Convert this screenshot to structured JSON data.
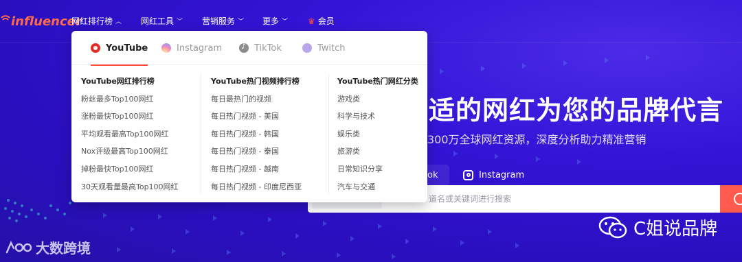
{
  "brand": {
    "logo_text": "influencer"
  },
  "nav": {
    "items": [
      {
        "label": "网红排行榜",
        "chevron": "up"
      },
      {
        "label": "网红工具",
        "chevron": "down"
      },
      {
        "label": "营销服务",
        "chevron": "down"
      },
      {
        "label": "更多",
        "chevron": "down"
      }
    ],
    "member_label": "会员"
  },
  "hero": {
    "title": "适的网红为您的品牌代言",
    "subtitle": "300万全球网红资源，深度分析助力精准营销",
    "platforms": [
      {
        "label": "ok",
        "icon": "tiktok-icon"
      },
      {
        "label": "Instagram",
        "icon": "instagram-icon"
      }
    ],
    "search": {
      "placeholder": "道名或关键词进行搜索"
    }
  },
  "dropdown": {
    "tabs": [
      {
        "label": "YouTube",
        "icon": "youtube-icon",
        "active": true
      },
      {
        "label": "Instagram",
        "icon": "instagram-icon",
        "active": false
      },
      {
        "label": "TikTok",
        "icon": "tiktok-icon",
        "active": false
      },
      {
        "label": "Twitch",
        "icon": "twitch-icon",
        "active": false
      }
    ],
    "columns": [
      {
        "heading": "YouTube网红排行榜",
        "links": [
          "粉丝最多Top100网红",
          "涨粉最快Top100网红",
          "平均观看最高Top100网红",
          "Nox评级最高Top100网红",
          "掉粉最快Top100网红",
          "30天观看量最高Top100网红"
        ]
      },
      {
        "heading": "YouTube热门视频排行榜",
        "links": [
          "每日最热门的视频",
          "每日热门视频 - 美国",
          "每日热门视频 - 韩国",
          "每日热门视频 - 泰国",
          "每日热门视频 - 越南",
          "每日热门视频 - 印度尼西亚"
        ]
      },
      {
        "heading": "YouTube热门网红分类",
        "links": [
          "游戏类",
          "科学与技术",
          "娱乐类",
          "旅游类",
          "日常知识分享",
          "汽车与交通"
        ]
      }
    ]
  },
  "watermarks": {
    "left_text": "大数跨境",
    "right_text": "C姐说品牌"
  },
  "colors": {
    "background": "#2a10c8",
    "accent": "#ff4d3d",
    "youtube_red": "#e52d27"
  }
}
